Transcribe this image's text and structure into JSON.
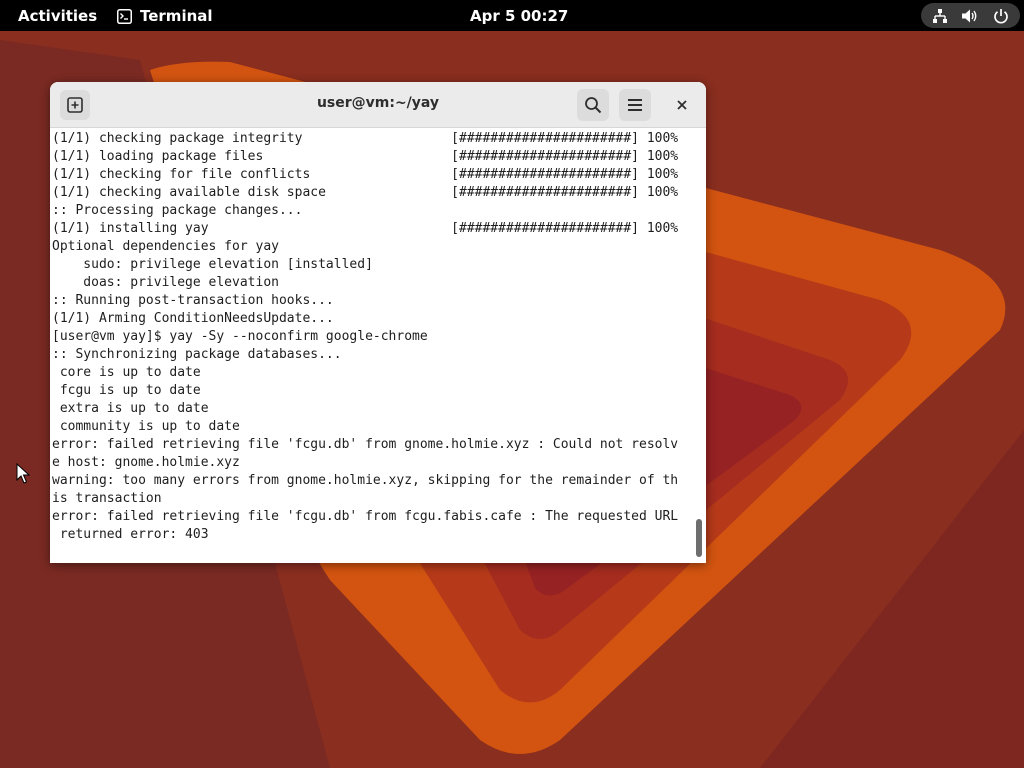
{
  "topbar": {
    "activities_label": "Activities",
    "app_name": "Terminal",
    "clock": "Apr 5  00:27",
    "tray_icons": [
      "network-icon",
      "volume-icon",
      "power-icon"
    ]
  },
  "terminal": {
    "title": "user@vm:~/yay",
    "lines": [
      "(1/1) checking package integrity                   [######################] 100%",
      "(1/1) loading package files                        [######################] 100%",
      "(1/1) checking for file conflicts                  [######################] 100%",
      "(1/1) checking available disk space                [######################] 100%",
      ":: Processing package changes...",
      "(1/1) installing yay                               [######################] 100%",
      "Optional dependencies for yay",
      "    sudo: privilege elevation [installed]",
      "    doas: privilege elevation",
      ":: Running post-transaction hooks...",
      "(1/1) Arming ConditionNeedsUpdate...",
      "[user@vm yay]$ yay -Sy --noconfirm google-chrome",
      ":: Synchronizing package databases...",
      " core is up to date",
      " fcgu is up to date",
      " extra is up to date",
      " community is up to date",
      "error: failed retrieving file 'fcgu.db' from gnome.holmie.xyz : Could not resolv",
      "e host: gnome.holmie.xyz",
      "warning: too many errors from gnome.holmie.xyz, skipping for the remainder of th",
      "is transaction",
      "error: failed retrieving file 'fcgu.db' from fcgu.fabis.cafe : The requested URL",
      " returned error: 403"
    ]
  },
  "colors": {
    "topbar_bg": "#000000",
    "titlebar_bg": "#ebebeb",
    "terminal_bg": "#ffffff",
    "terminal_fg": "#1e1e1e",
    "wallpaper_base": "#8a2e1f",
    "wallpaper_orange": "#d9570f",
    "wallpaper_red": "#a8281f",
    "wallpaper_dark": "#2a2438"
  }
}
